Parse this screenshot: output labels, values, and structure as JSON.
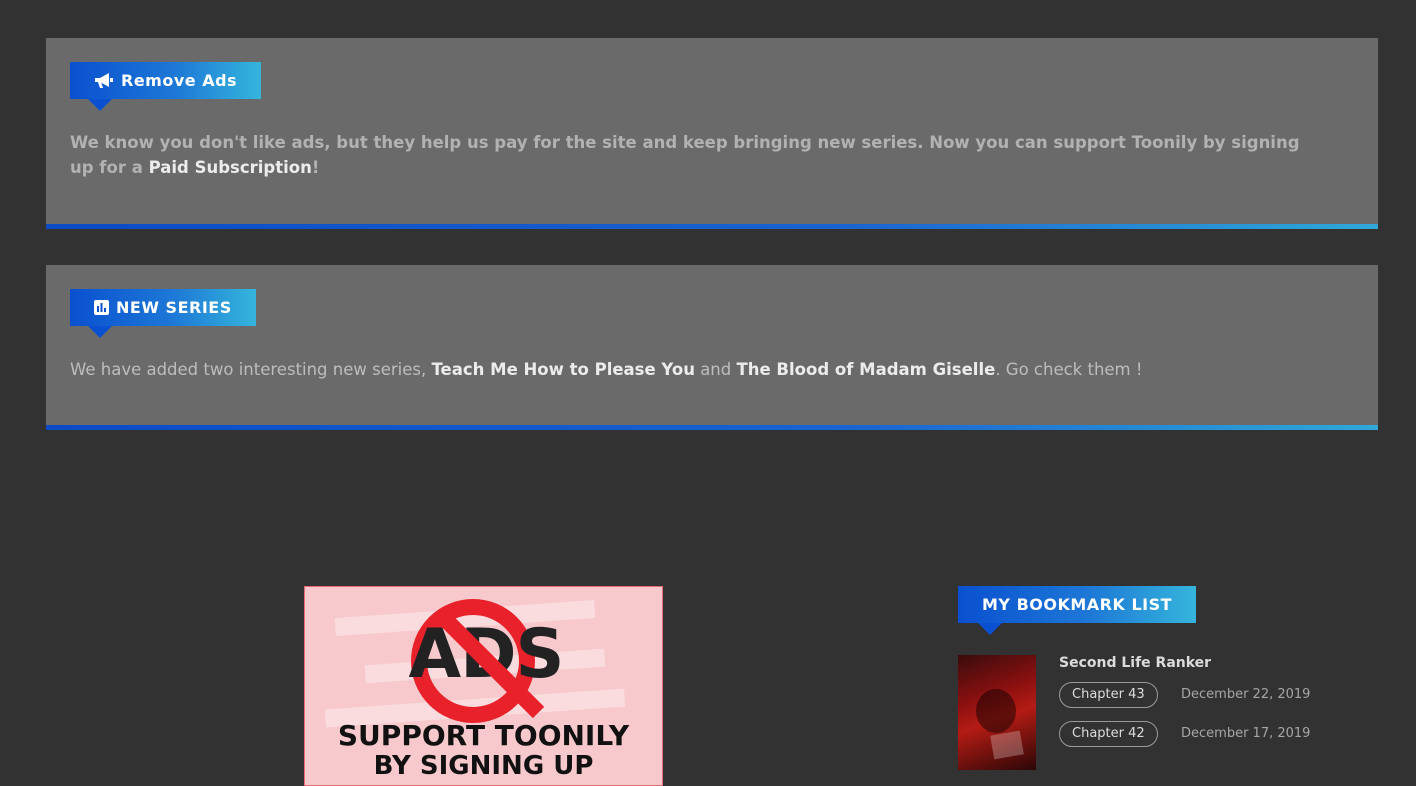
{
  "remove_ads": {
    "heading": "Remove Ads",
    "text_before": "We know you don't like ads, but they help us pay for the site and keep bringing new series. Now you can support Toonily by signing up for a ",
    "link_text": "Paid Subscription",
    "text_after": "!"
  },
  "new_series": {
    "heading": "NEW SERIES",
    "text_before": "We have added two interesting new series, ",
    "series_1": "Teach Me How to Please You",
    "between": " and ",
    "series_2": "The Blood of Madam Giselle",
    "text_after": ". Go check them !"
  },
  "ad_banner": {
    "word": "ADS",
    "line1": "SUPPORT TOONILY",
    "line2": "BY SIGNING UP"
  },
  "bookmarks": {
    "heading": "MY BOOKMARK LIST",
    "items": [
      {
        "title": "Second Life Ranker",
        "chapters": [
          {
            "label": "Chapter 43",
            "date": "December 22, 2019"
          },
          {
            "label": "Chapter 42",
            "date": "December 17, 2019"
          }
        ]
      }
    ]
  },
  "colors": {
    "page_bg": "#323232",
    "panel_bg": "#6a6a6a",
    "accent_start": "#0a50d0",
    "accent_end": "#35b5dc",
    "ad_red": "#e8212a"
  },
  "icons": {
    "remove_ads": "bullhorn-icon",
    "new_series": "bar-chart-icon"
  }
}
